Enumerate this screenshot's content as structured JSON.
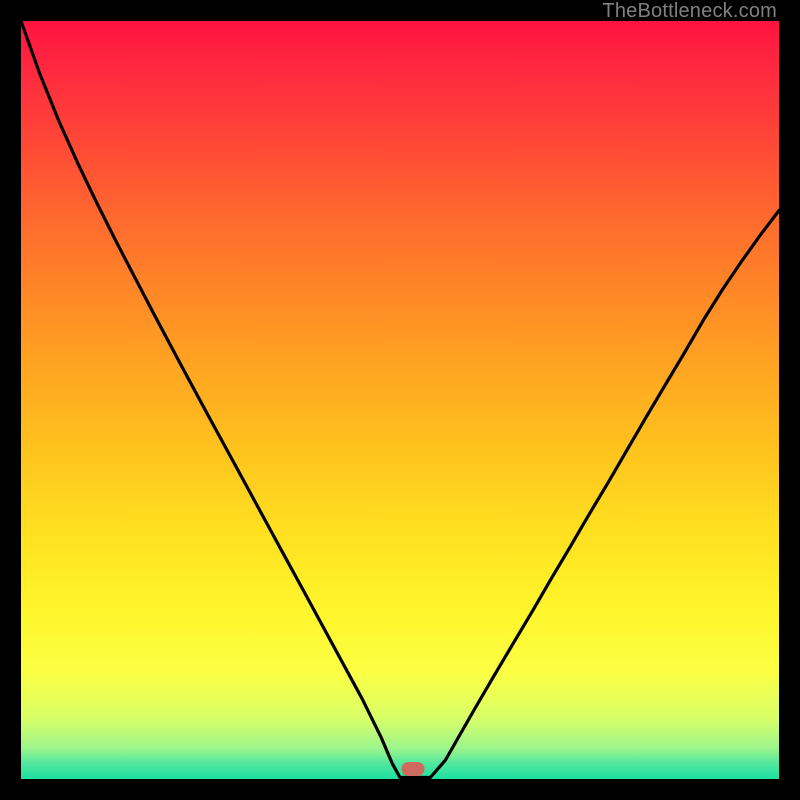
{
  "watermark": "TheBottleneck.com",
  "marker": {
    "color": "#cf6a5f",
    "x_frac": 0.517,
    "y_frac": 0.987
  },
  "chart_data": {
    "type": "line",
    "title": "",
    "xlabel": "",
    "ylabel": "",
    "xlim": [
      0,
      1
    ],
    "ylim": [
      0,
      1
    ],
    "x": [
      0.0,
      0.025,
      0.05,
      0.075,
      0.1,
      0.125,
      0.15,
      0.175,
      0.2,
      0.225,
      0.25,
      0.275,
      0.3,
      0.325,
      0.35,
      0.375,
      0.4,
      0.425,
      0.45,
      0.475,
      0.49,
      0.5,
      0.52,
      0.54,
      0.56,
      0.58,
      0.6,
      0.625,
      0.65,
      0.675,
      0.7,
      0.725,
      0.75,
      0.775,
      0.8,
      0.825,
      0.85,
      0.875,
      0.9,
      0.925,
      0.95,
      0.975,
      1.0
    ],
    "values": [
      1.0,
      0.93,
      0.868,
      0.812,
      0.76,
      0.71,
      0.662,
      0.614,
      0.567,
      0.52,
      0.474,
      0.428,
      0.382,
      0.336,
      0.29,
      0.244,
      0.198,
      0.152,
      0.106,
      0.055,
      0.02,
      0.001,
      0.001,
      0.001,
      0.025,
      0.06,
      0.095,
      0.138,
      0.18,
      0.222,
      0.265,
      0.307,
      0.35,
      0.392,
      0.435,
      0.478,
      0.52,
      0.562,
      0.605,
      0.645,
      0.682,
      0.717,
      0.75
    ],
    "marker_point": {
      "x": 0.517,
      "y": 0.0
    },
    "background_gradient": "red-yellow-green vertical"
  }
}
